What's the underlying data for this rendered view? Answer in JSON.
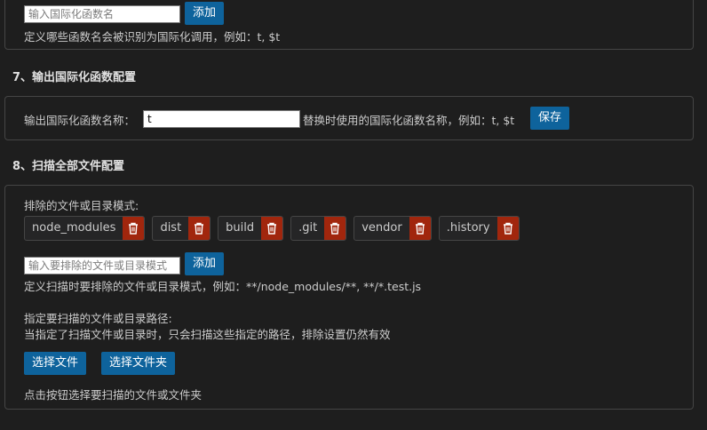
{
  "top_section": {
    "input_placeholder": "输入国际化函数名",
    "add_label": "添加",
    "hint": "定义哪些函数名会被识别为国际化调用，例如：t, $t"
  },
  "section7": {
    "title": "7、输出国际化函数配置",
    "field_label": "输出国际化函数名称：",
    "field_value": "t",
    "field_hint": "替换时使用的国际化函数名称，例如：t, $t",
    "save_label": "保存"
  },
  "section8": {
    "title": "8、扫描全部文件配置",
    "exclude_label": "排除的文件或目录模式:",
    "exclude_patterns": [
      "node_modules",
      "dist",
      "build",
      ".git",
      "vendor",
      ".history"
    ],
    "exclude_input_placeholder": "输入要排除的文件或目录模式",
    "add_label": "添加",
    "exclude_hint": "定义扫描时要排除的文件或目录模式，例如：**/node_modules/**, **/*.test.js",
    "include_label": "指定要扫描的文件或目录路径:",
    "include_desc": "当指定了扫描文件或目录时，只会扫描这些指定的路径，排除设置仍然有效",
    "select_file_label": "选择文件",
    "select_folder_label": "选择文件夹",
    "select_hint": "点击按钮选择要扫描的文件或文件夹"
  },
  "icons": {
    "delete": "trash-icon"
  }
}
